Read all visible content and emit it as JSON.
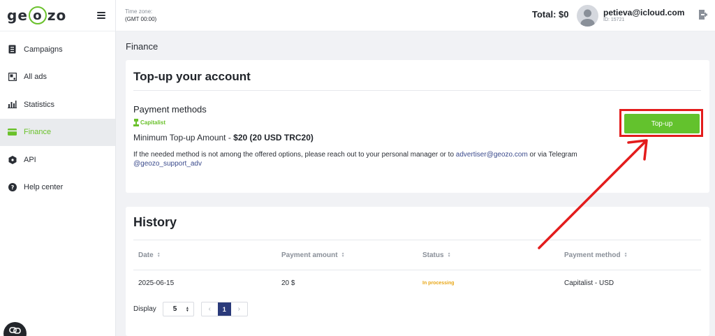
{
  "brand": {
    "logo_prefix": "ge",
    "logo_mid": "o",
    "logo_suffix": "zo",
    "accent": "#6ac12b"
  },
  "sidebar": {
    "items": [
      {
        "label": "Campaigns",
        "icon": "campaigns-icon"
      },
      {
        "label": "All ads",
        "icon": "ads-icon"
      },
      {
        "label": "Statistics",
        "icon": "statistics-icon"
      },
      {
        "label": "Finance",
        "icon": "finance-icon",
        "active": true
      },
      {
        "label": "API",
        "icon": "api-icon"
      },
      {
        "label": "Help center",
        "icon": "help-icon"
      }
    ]
  },
  "header": {
    "timezone_label": "Time zone:",
    "timezone_value": "(GMT 00:00)",
    "total": "Total: $0",
    "user_email": "petieva@icloud.com",
    "user_id": "ID: 15721"
  },
  "page": {
    "title": "Finance"
  },
  "topup": {
    "heading": "Top-up your account",
    "payment_methods_title": "Payment methods",
    "method_logo_text": "Capitalist",
    "min_amount_label": "Minimum Top-up Amount - ",
    "min_amount_value": "$20 (20 USD TRC20)",
    "info_text": "If the needed method is not among the offered options, please reach out to your personal manager or to ",
    "info_email": "advertiser@geozo.com",
    "info_or": " or via Telegram",
    "info_telegram": "@geozo_support_adv",
    "button_label": "Top-up",
    "button_color": "#63c22d",
    "highlight_color": "#e31c1c"
  },
  "history": {
    "heading": "History",
    "columns": [
      "Date",
      "Payment amount",
      "Status",
      "Payment method"
    ],
    "rows": [
      {
        "date": "2025-06-15",
        "amount": "20 $",
        "status": "In processing",
        "method": "Capitalist - USD"
      }
    ],
    "display_label": "Display",
    "display_value": "5",
    "current_page": "1",
    "prev": "‹",
    "next": "›"
  }
}
